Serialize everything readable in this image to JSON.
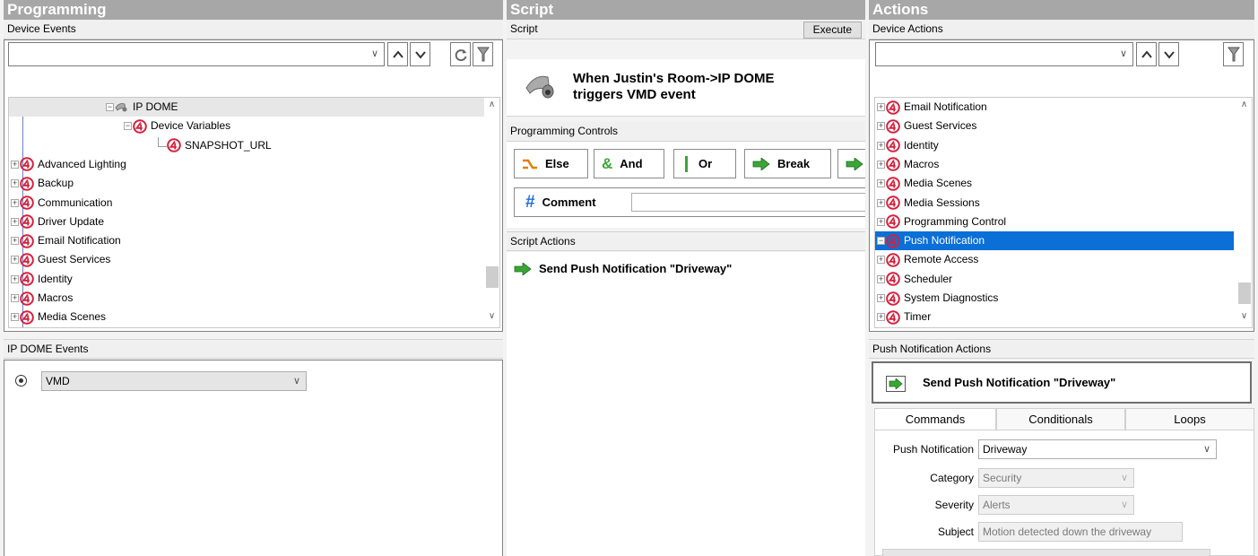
{
  "programming": {
    "title": "Programming",
    "device_events_label": "Device Events",
    "tree": [
      {
        "label": "IP DOME",
        "indent": 106,
        "expander": "−",
        "icon": "camera",
        "selected": true
      },
      {
        "label": "Device Variables",
        "indent": 126,
        "expander": "−",
        "icon": "c4"
      },
      {
        "label": "SNAPSHOT_URL",
        "indent": 164,
        "expander": "",
        "icon": "c4"
      },
      {
        "label": "Advanced Lighting",
        "indent": 0,
        "expander": "+",
        "icon": "c4"
      },
      {
        "label": "Backup",
        "indent": 0,
        "expander": "+",
        "icon": "c4"
      },
      {
        "label": "Communication",
        "indent": 0,
        "expander": "+",
        "icon": "c4"
      },
      {
        "label": "Driver Update",
        "indent": 0,
        "expander": "+",
        "icon": "c4"
      },
      {
        "label": "Email Notification",
        "indent": 0,
        "expander": "+",
        "icon": "c4"
      },
      {
        "label": "Guest Services",
        "indent": 0,
        "expander": "+",
        "icon": "c4"
      },
      {
        "label": "Identity",
        "indent": 0,
        "expander": "+",
        "icon": "c4"
      },
      {
        "label": "Macros",
        "indent": 0,
        "expander": "+",
        "icon": "c4"
      },
      {
        "label": "Media Scenes",
        "indent": 0,
        "expander": "+",
        "icon": "c4"
      }
    ],
    "events_label": "IP DOME Events",
    "event_selected": "VMD"
  },
  "script": {
    "title": "Script",
    "section_label": "Script",
    "execute_label": "Execute",
    "trigger_text_line1": "When Justin's Room->IP DOME",
    "trigger_text_line2": "triggers VMD event",
    "controls_label": "Programming Controls",
    "controls": [
      {
        "label": "Else",
        "name": "else-button"
      },
      {
        "label": "And",
        "name": "and-button"
      },
      {
        "label": "Or",
        "name": "or-button"
      },
      {
        "label": "Break",
        "name": "break-button"
      }
    ],
    "comment_label": "Comment",
    "comment_value": "",
    "actions_label": "Script Actions",
    "action_text": "Send Push Notification \"Driveway\""
  },
  "actions": {
    "title": "Actions",
    "device_actions_label": "Device Actions",
    "tree": [
      {
        "label": "Email Notification",
        "expander": "+"
      },
      {
        "label": "Guest Services",
        "expander": "+"
      },
      {
        "label": "Identity",
        "expander": "+"
      },
      {
        "label": "Macros",
        "expander": "+"
      },
      {
        "label": "Media Scenes",
        "expander": "+"
      },
      {
        "label": "Media Sessions",
        "expander": "+"
      },
      {
        "label": "Programming Control",
        "expander": "+"
      },
      {
        "label": "Push Notification",
        "expander": "−",
        "selected": true
      },
      {
        "label": "Remote Access",
        "expander": "+"
      },
      {
        "label": "Scheduler",
        "expander": "+"
      },
      {
        "label": "System Diagnostics",
        "expander": "+"
      },
      {
        "label": "Timer",
        "expander": "+"
      }
    ],
    "push_actions_label": "Push Notification Actions",
    "push_action_text": "Send Push Notification \"Driveway\"",
    "tabs": [
      "Commands",
      "Conditionals",
      "Loops"
    ],
    "form": {
      "push_label": "Push Notification",
      "push_value": "Driveway",
      "category_label": "Category",
      "category_value": "Security",
      "severity_label": "Severity",
      "severity_value": "Alerts",
      "subject_label": "Subject",
      "subject_value": "Motion detected down the driveway"
    }
  },
  "colors": {
    "header_gray": "#a7a7a7",
    "selection_blue": "#0a6fd6",
    "c4_red": "#d4213d",
    "arrow_green": "#3aa637"
  }
}
